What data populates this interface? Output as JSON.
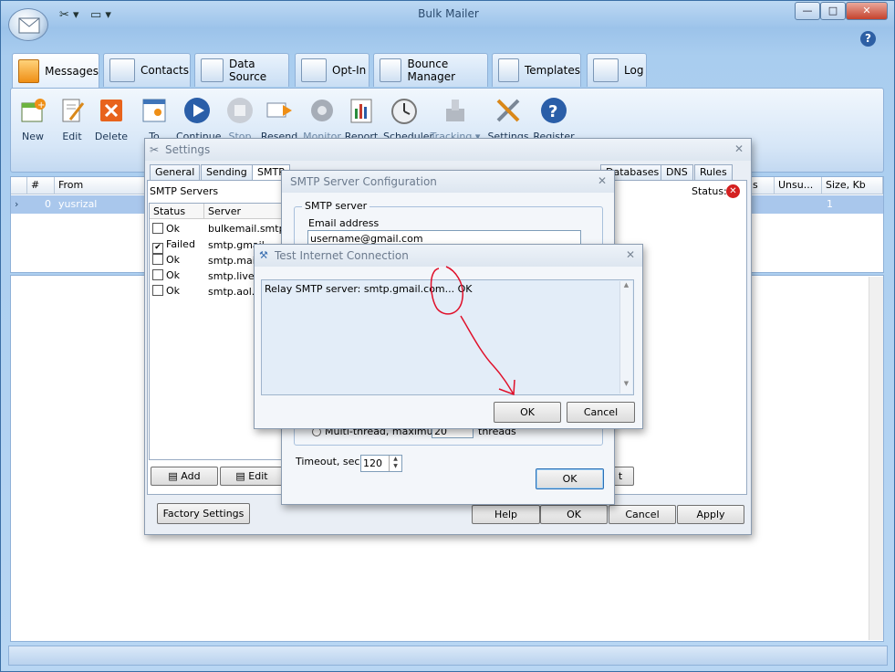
{
  "app": {
    "title": "Bulk Mailer",
    "window_controls": {
      "minimize": "—",
      "maximize": "□",
      "close": "✕"
    },
    "help": "?"
  },
  "tabs": [
    {
      "label": "Messages",
      "active": true
    },
    {
      "label": "Contacts"
    },
    {
      "label": "Data Source"
    },
    {
      "label": "Opt-In"
    },
    {
      "label": "Bounce Manager"
    },
    {
      "label": "Templates"
    },
    {
      "label": "Log"
    }
  ],
  "ribbon": [
    {
      "label": "New",
      "icon": "new-message-icon"
    },
    {
      "label": "Edit",
      "icon": "edit-icon"
    },
    {
      "label": "Delete",
      "icon": "delete-icon"
    },
    {
      "label": "To",
      "icon": "recipients-icon"
    },
    {
      "label": "Continue",
      "icon": "play-icon"
    },
    {
      "label": "Stop",
      "icon": "stop-icon"
    },
    {
      "label": "Resend",
      "icon": "resend-icon"
    },
    {
      "label": "Monitor",
      "icon": "gear-icon"
    },
    {
      "label": "Report",
      "icon": "report-icon"
    },
    {
      "label": "Scheduler",
      "icon": "clock-icon"
    },
    {
      "label": "Tracking",
      "icon": "tracking-icon"
    },
    {
      "label": "Settings",
      "icon": "tools-icon"
    },
    {
      "label": "Register",
      "icon": "help-icon"
    }
  ],
  "grid": {
    "headers": [
      "#",
      "From",
      "s",
      "Unsu...",
      "Size, Kb"
    ],
    "row": {
      "num": "0",
      "from": "yusrizal",
      "size": "1"
    }
  },
  "settings": {
    "title": "Settings",
    "tabs": [
      "General",
      "Sending",
      "SMTP",
      "Databases",
      "DNS",
      "Rules"
    ],
    "smtp_servers_label": "SMTP Servers",
    "status_label": "Status:",
    "list_headers": [
      "Status",
      "Server"
    ],
    "servers": [
      {
        "status": "Ok",
        "server": "bulkemail.smtp...",
        "checked": false
      },
      {
        "status": "Failed",
        "server": "smtp.gmail",
        "checked": true
      },
      {
        "status": "Ok",
        "server": "smtp.mail.",
        "checked": false
      },
      {
        "status": "Ok",
        "server": "smtp.live.c",
        "checked": false
      },
      {
        "status": "Ok",
        "server": "smtp.aol.c",
        "checked": false
      }
    ],
    "add": "Add",
    "edit": "Edit",
    "partial_button": "t",
    "factory": "Factory Settings",
    "help": "Help",
    "ok": "OK",
    "cancel": "Cancel",
    "apply": "Apply"
  },
  "smtp_config": {
    "title": "SMTP Server Configuration",
    "group": "SMTP server",
    "email_label": "Email address",
    "email_value": "username@gmail.com",
    "multithread_label": "Multi-thread, maximum",
    "multithread_value": "20",
    "threads_label": "threads",
    "timeout_label": "Timeout, sec",
    "timeout_value": "120",
    "ok": "OK"
  },
  "test_conn": {
    "title": "Test Internet Connection",
    "message": "Relay SMTP server: smtp.gmail.com... OK",
    "ok": "OK",
    "cancel": "Cancel"
  },
  "colors": {
    "selection": "#a9c7ec",
    "annotation": "#e0102a",
    "close_button": "#c5422d"
  }
}
